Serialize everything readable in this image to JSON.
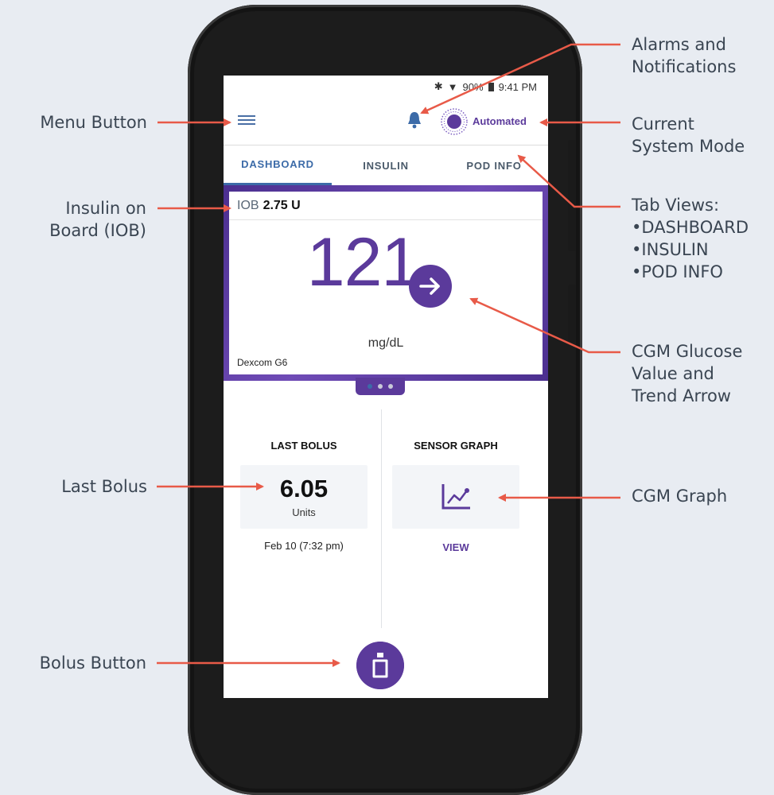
{
  "status_bar": {
    "bluetooth_icon": "bluetooth-icon",
    "wifi_icon": "wifi-icon",
    "battery_text": "90%",
    "time": "9:41 PM"
  },
  "app_bar": {
    "menu_icon": "menu-icon",
    "bell_icon": "bell-icon",
    "mode_icon": "automated-mode-icon",
    "mode_label": "Automated"
  },
  "tabs": [
    {
      "label": "DASHBOARD",
      "active": true
    },
    {
      "label": "INSULIN",
      "active": false
    },
    {
      "label": "POD INFO",
      "active": false
    }
  ],
  "iob": {
    "label": "IOB",
    "value": "2.75 U"
  },
  "glucose": {
    "value": "121",
    "units": "mg/dL",
    "source": "Dexcom G6",
    "trend_icon": "arrow-right-icon"
  },
  "pager": {
    "count": 3,
    "active_index": 0
  },
  "last_bolus": {
    "title": "LAST BOLUS",
    "value": "6.05",
    "units": "Units",
    "date": "Feb 10 (7:32 pm)"
  },
  "sensor_graph": {
    "title": "SENSOR GRAPH",
    "icon": "line-chart-icon",
    "link": "VIEW"
  },
  "bolus_button": {
    "icon": "bolus-pod-icon"
  },
  "callouts": {
    "menu_button": "Menu Button",
    "iob_line1": "Insulin on",
    "iob_line2": "Board (IOB)",
    "last_bolus": "Last Bolus",
    "bolus_button": "Bolus Button",
    "alarms_line1": "Alarms and",
    "alarms_line2": "Notifications",
    "mode_line1": "Current",
    "mode_line2": "System Mode",
    "tabs_title": "Tab Views:",
    "tab_items": [
      "DASHBOARD",
      "INSULIN",
      "POD INFO"
    ],
    "cgm_line1": "CGM Glucose",
    "cgm_line2": "Value and",
    "cgm_line3": "Trend Arrow",
    "cgm_graph": "CGM Graph"
  },
  "colors": {
    "accent_purple": "#5b3a9b",
    "tab_blue": "#3c6ba8",
    "arrow_red": "#e85a48",
    "background": "#e8ecf2"
  }
}
